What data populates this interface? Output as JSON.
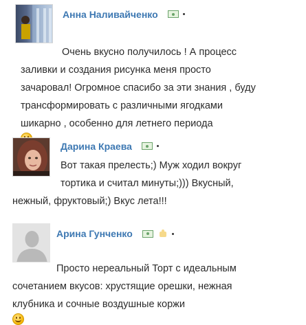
{
  "comments": [
    {
      "author": "Анна Наливайченко",
      "lines": [
        "Очень вкусно получилось ! А процесс",
        "заливки и создания рисунка меня просто",
        "зачаровал! Огромное спасибо за эти знания , буду",
        "трансформировать с различными ягодками",
        "шикарно , особенно для летнего периода"
      ],
      "emoji": "smile-emoji"
    },
    {
      "author": "Дарина Краева",
      "lines": [
        "Вот такая прелесть;) Муж ходил вокруг",
        "тортика и считал минуты;))) Вкусный,",
        "нежный, фруктовый;) Вкус лета!!!"
      ]
    },
    {
      "author": "Арина Гунченко",
      "lines": [
        "Просто нереальный Торт с идеальным",
        "сочетанием вкусов: хрустящие орешки, нежная",
        "клубника и сочные воздушные коржи"
      ],
      "emoji": "smile-emoji"
    }
  ],
  "icons": [
    "money-badge-icon",
    "thumbs-up-icon",
    "default-avatar-icon"
  ],
  "colors": {
    "author": "#3d78b2",
    "text": "#2b2b2b",
    "badge": "#6aa36a"
  }
}
